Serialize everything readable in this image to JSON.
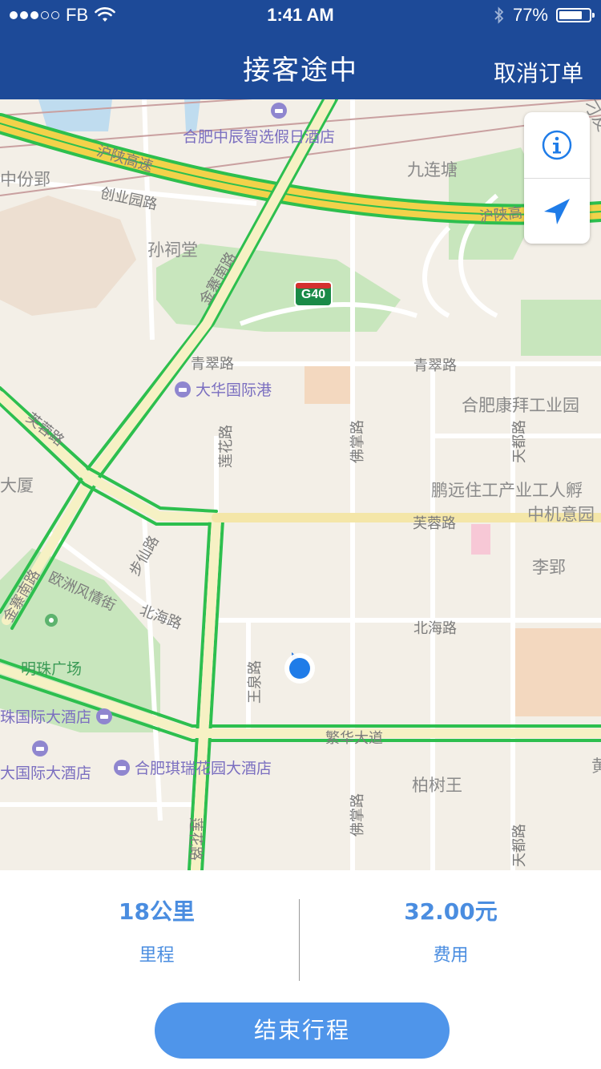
{
  "status_bar": {
    "signal_dots_filled": 3,
    "signal_dots_total": 5,
    "carrier": "FB",
    "time": "1:41 AM",
    "battery_percent": "77%",
    "battery_level": 0.77,
    "icons": [
      "wifi-icon",
      "bluetooth-icon",
      "battery-icon"
    ]
  },
  "nav": {
    "title": "接客途中",
    "cancel_label": "取消订单"
  },
  "map": {
    "highway_shield": "G40",
    "labels": {
      "road_hushan_1": "沪陕高速",
      "road_hushan_2": "沪陕高",
      "road_chuangye": "创业园路",
      "road_jinzhai_n": "金寨南路",
      "road_jinzhai_s": "金寨南路",
      "road_qingcui_w": "青翠路",
      "road_qingcui_e": "青翠路",
      "road_furong_w": "芙蓉路",
      "road_furong_e": "芙蓉路",
      "road_lianhua_n": "莲花路",
      "road_lianhua_s": "莲花路",
      "road_fozhang_n": "佛掌路",
      "road_fozhang_s": "佛掌路",
      "road_tiandu_n": "天都路",
      "road_tiandu_s": "天都路",
      "road_buxian": "步仙路",
      "road_ouzhou": "欧洲风情街",
      "road_beihai_w": "北海路",
      "road_beihai_e": "北海路",
      "road_wangquan": "王泉路",
      "road_fanhua": "繁华大道",
      "area_jiulian": "九连塘",
      "area_zhongfen": "中份郢",
      "area_suncitang": "孙祠堂",
      "area_kangbai": "合肥康拜工业园",
      "area_pengyuan": "鹏远住工产业工人孵",
      "area_zhongji": "中机意园",
      "area_liying": "李郢",
      "area_dasha": "大厦",
      "area_baishu": "柏树王",
      "area_mingzhu": "明珠广场",
      "area_edge": "刁友",
      "area_edge2": "黄",
      "poi_chenzhi": "合肥中辰智选假日酒店",
      "poi_dahua": "大华国际港",
      "poi_zhuguoji": "珠国际大酒店",
      "poi_daguoji": "大国际大酒店",
      "poi_qirui": "合肥琪瑞花园大酒店"
    }
  },
  "trip": {
    "distance_value": "18公里",
    "distance_label": "里程",
    "fee_value": "32.00元",
    "fee_label": "费用",
    "end_button": "结束行程"
  },
  "colors": {
    "header": "#1d4a98",
    "accent": "#4f95ea",
    "stat_text": "#4a8de0",
    "traffic_green": "#2dbf4e",
    "highway_yellow": "#f2d24a"
  }
}
